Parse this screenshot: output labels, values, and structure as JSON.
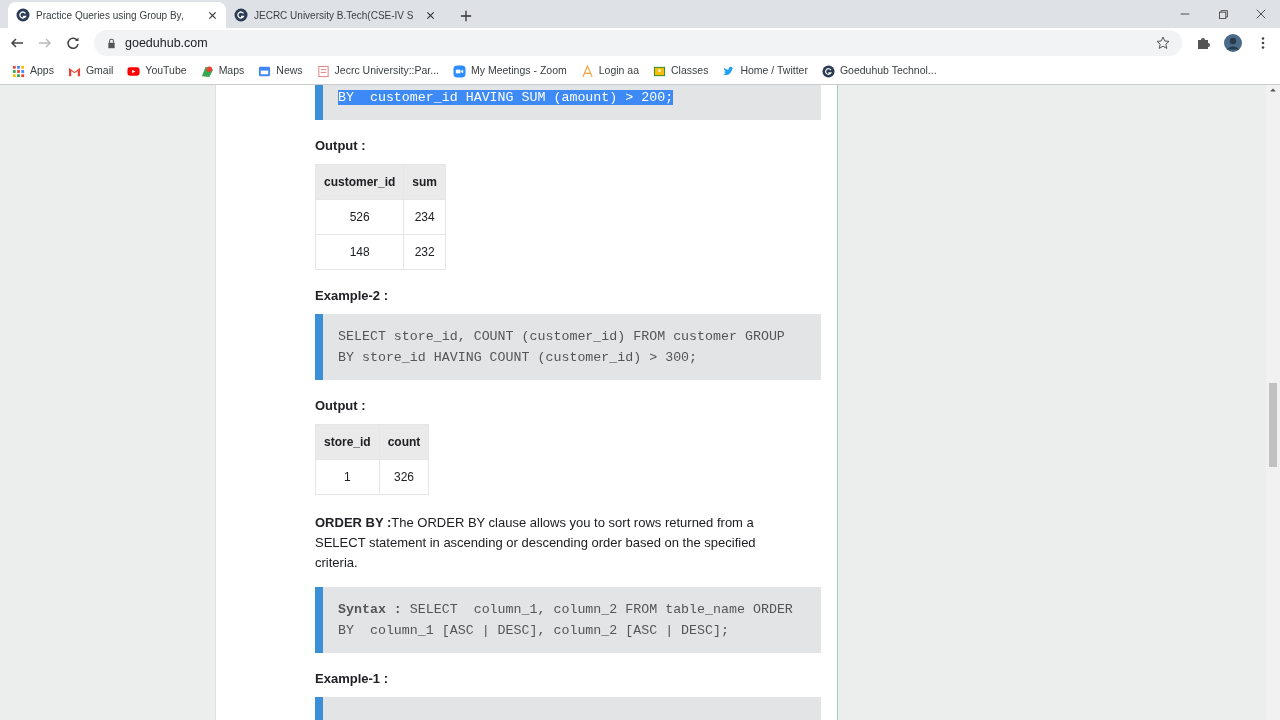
{
  "browser": {
    "tabs": [
      {
        "title": "Practice Queries using Group By,",
        "selected": true
      },
      {
        "title": "JECRC University B.Tech(CSE-IV S",
        "selected": false
      }
    ],
    "address": "goeduhub.com",
    "bookmarks": [
      "Apps",
      "Gmail",
      "YouTube",
      "Maps",
      "News",
      "Jecrc University::Par...",
      "My Meetings - Zoom",
      "Login aa",
      "Classes",
      "Home / Twitter",
      "Goeduhub Technol..."
    ]
  },
  "content": [
    {
      "kind": "code",
      "text": "BY  customer_id HAVING SUM (amount) > 200;",
      "highlighted": true
    },
    {
      "kind": "heading",
      "text": "Output :"
    },
    {
      "kind": "table",
      "columns": [
        "customer_id",
        "sum"
      ],
      "rows": [
        [
          "526",
          "234"
        ],
        [
          "148",
          "232"
        ]
      ]
    },
    {
      "kind": "heading",
      "text": "Example-2 :"
    },
    {
      "kind": "code",
      "text": "SELECT store_id, COUNT (customer_id) FROM customer GROUP BY store_id HAVING COUNT (customer_id) > 300;",
      "highlighted": false
    },
    {
      "kind": "heading",
      "text": "Output :"
    },
    {
      "kind": "table",
      "columns": [
        "store_id",
        "count"
      ],
      "rows": [
        [
          "1",
          "326"
        ]
      ]
    },
    {
      "kind": "paragraph",
      "text": "**ORDER BY :**The ORDER BY clause allows you to sort rows returned from a SELECT statement in ascending or descending order based on the specified criteria."
    },
    {
      "kind": "code",
      "text": "**Syntax :** SELECT  column_1, column_2 FROM table_name ORDER BY  column_1 [ASC | DESC], column_2 [ASC | DESC];",
      "highlighted": false
    },
    {
      "kind": "heading",
      "text": "Example-1 :"
    },
    {
      "kind": "code_cut"
    }
  ]
}
